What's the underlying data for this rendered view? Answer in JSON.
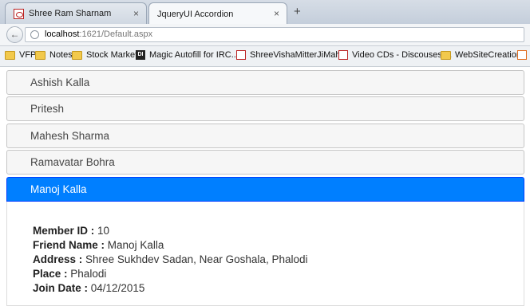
{
  "browser": {
    "tabs": [
      {
        "title": "Shree Ram Sharnam",
        "active": false
      },
      {
        "title": "JqueryUI Accordion",
        "active": true
      }
    ],
    "tab_close_glyph": "×",
    "new_tab_glyph": "+",
    "url_host": "localhost",
    "url_rest": ":1621/Default.aspx",
    "bookmarks": [
      {
        "label": "VFP",
        "icon": "folder-icon"
      },
      {
        "label": "Notes",
        "icon": "folder-icon"
      },
      {
        "label": "Stock Market",
        "icon": "folder-icon"
      },
      {
        "label": "Magic Autofill for IRC...",
        "icon": "di-icon"
      },
      {
        "label": "ShreeVishaMitterJiMah...",
        "icon": "red-page-icon"
      },
      {
        "label": "Video CDs - Discouses ...",
        "icon": "red-page-icon"
      },
      {
        "label": "WebSiteCreation",
        "icon": "folder-icon"
      }
    ],
    "di_icon_text": "DI"
  },
  "accordion": {
    "headers": [
      "Ashish Kalla",
      "Pritesh",
      "Mahesh Sharma",
      "Ramavatar Bohra",
      "Manoj Kalla"
    ],
    "active_index": 4,
    "panel": {
      "member_id_label": "Member ID :",
      "member_id": "10",
      "friend_name_label": "Friend Name :",
      "friend_name": "Manoj Kalla",
      "address_label": "Address :",
      "address": "Shree Sukhdev Sadan, Near Goshala, Phalodi",
      "place_label": "Place :",
      "place": "Phalodi",
      "join_date_label": "Join Date :",
      "join_date": "04/12/2015"
    }
  },
  "colors": {
    "active_header_bg": "#007fff",
    "header_bg": "#f6f6f6"
  }
}
